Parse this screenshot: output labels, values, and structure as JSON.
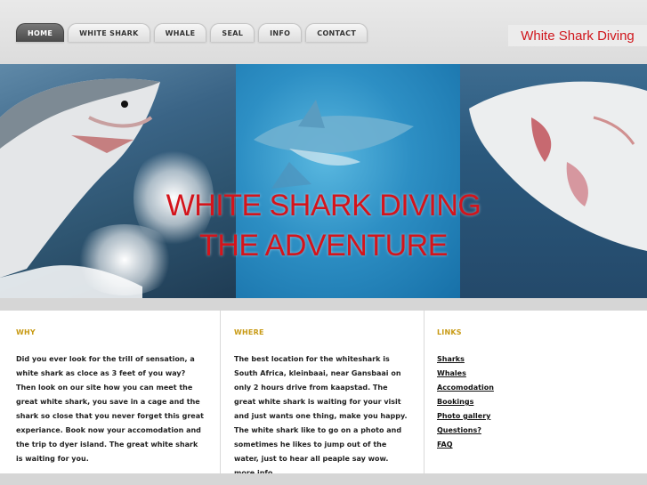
{
  "nav": {
    "tabs": [
      {
        "label": "HOME",
        "active": true
      },
      {
        "label": "WHITE SHARK",
        "active": false
      },
      {
        "label": "WHALE",
        "active": false
      },
      {
        "label": "SEAL",
        "active": false
      },
      {
        "label": "INFO",
        "active": false
      },
      {
        "label": "CONTACT",
        "active": false
      }
    ]
  },
  "brand": {
    "title": "White Shark Diving"
  },
  "banner": {
    "line1": "WHITE SHARK DIVING",
    "line2": "THE ADVENTURE"
  },
  "why": {
    "heading": "WHY",
    "text": "Did you ever look for the trill of sensation, a white shark as cloce as 3 feet of you way? Then look on our site how you can meet the great white shark, you save in a cage and the shark so close that you never forget this great experiance. Book now your accomodation and the trip to dyer island. The great white shark is waiting for you."
  },
  "where": {
    "heading": "WHERE",
    "text": "The best location for the whiteshark is South Africa, kleinbaai, near Gansbaai on only 2 hours drive from kaapstad. The great white shark is waiting for your visit and just wants one thing, make you happy. The white shark like to go on a photo and sometimes he likes to jump out of the water, just to hear all peaple say wow.",
    "more_link": " more info."
  },
  "links": {
    "heading": "LINKS",
    "items": [
      "Sharks",
      "Whales",
      "Accomodation",
      "Bookings",
      "Photo gallery",
      "Questions?",
      "FAQ"
    ]
  },
  "colors": {
    "accent": "#d4141b",
    "heading": "#c89a14",
    "brand": "#d0161c"
  }
}
